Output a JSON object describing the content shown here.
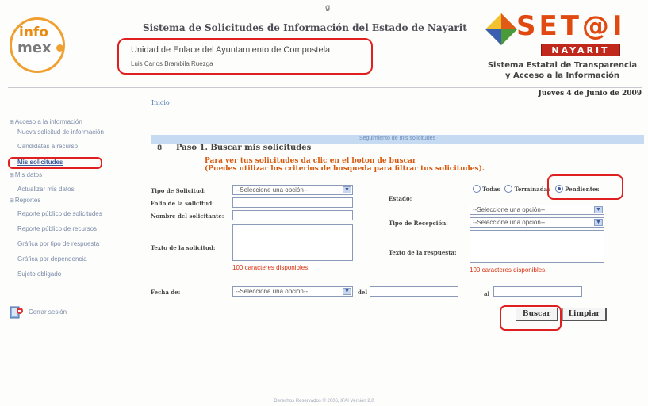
{
  "header": {
    "logo_top": "info",
    "logo_bottom": "mex",
    "tick": "g",
    "system_title": "Sistema de Solicitudes de Información del Estado de Nayarit",
    "unit_name": "Unidad de Enlace del Ayuntamiento de Compostela",
    "unit_person": "Luis Carlos Brambila Ruezga",
    "setai_text": "SET@I",
    "nayarit": "NAYARIT",
    "setai_sub1": "Sistema Estatal de Transparencia",
    "setai_sub2": "y Acceso a la Información",
    "date": "Jueves 4 de Junio de 2009",
    "breadcrumb": "Inicio"
  },
  "sidebar": {
    "items": [
      {
        "label": "Acceso a la información",
        "type": "section"
      },
      {
        "label": "Nueva solicitud de información",
        "type": "link"
      },
      {
        "label": "Candidatas a recurso",
        "type": "link"
      },
      {
        "label": "Mis solicitudes",
        "type": "link-active"
      },
      {
        "label": "Mis datos",
        "type": "section"
      },
      {
        "label": "Actualizar mis datos",
        "type": "link"
      },
      {
        "label": "Reportes",
        "type": "section"
      },
      {
        "label": "Reporte público de solicitudes",
        "type": "link"
      },
      {
        "label": "Reporte público de recursos",
        "type": "link"
      },
      {
        "label": "Gráfica por tipo de respuesta",
        "type": "link"
      },
      {
        "label": "Gráfica por dependencia",
        "type": "link"
      },
      {
        "label": "Sujeto obligado",
        "type": "link"
      }
    ],
    "logout": "Cerrar sesión"
  },
  "main": {
    "bar_title": "Seguimiento de mis solicitudes",
    "step_marker": "8",
    "step_title": "Paso 1. Buscar mis solicitudes",
    "instruction_1": "Para ver tus solicitudes da clic en el boton de buscar",
    "instruction_2": "(Puedes utilizar los criterios de busqueda para filtrar tus solicitudes).",
    "tipo_label": "Tipo de Solicitud:",
    "tipo_value": "--Seleccione una opción--",
    "folio_label": "Folio de la solicitud:",
    "nombre_label": "Nombre del solicitante:",
    "texto_sol_label": "Texto de la solicitud:",
    "chars_left": "100 caracteres disponibles.",
    "estado_label": "Estado:",
    "estado_options": [
      "Todas",
      "Terminadas",
      "Pendientes"
    ],
    "estado_selected": "Pendientes",
    "estado_select_value": "--Seleccione una opción--",
    "recepcion_label": "Tipo de Recepción:",
    "recepcion_value": "--Seleccione una opción--",
    "texto_resp_label": "Texto de la respuesta:",
    "chars_right": "100 caracteres disponibles.",
    "fecha_label": "Fecha de:",
    "fecha_value": "--Seleccione una opción--",
    "del_label": "del",
    "al_label": "al",
    "buscar": "Buscar",
    "limpiar": "Limpiar"
  },
  "footer": "Derechos Reservados © 2006, IFAI Versión 2.0",
  "colors": {
    "accent_orange": "#d85a10",
    "highlight_red": "#e02020",
    "bar_blue": "#c6dbf2",
    "link_blue": "#7a8aa8"
  }
}
